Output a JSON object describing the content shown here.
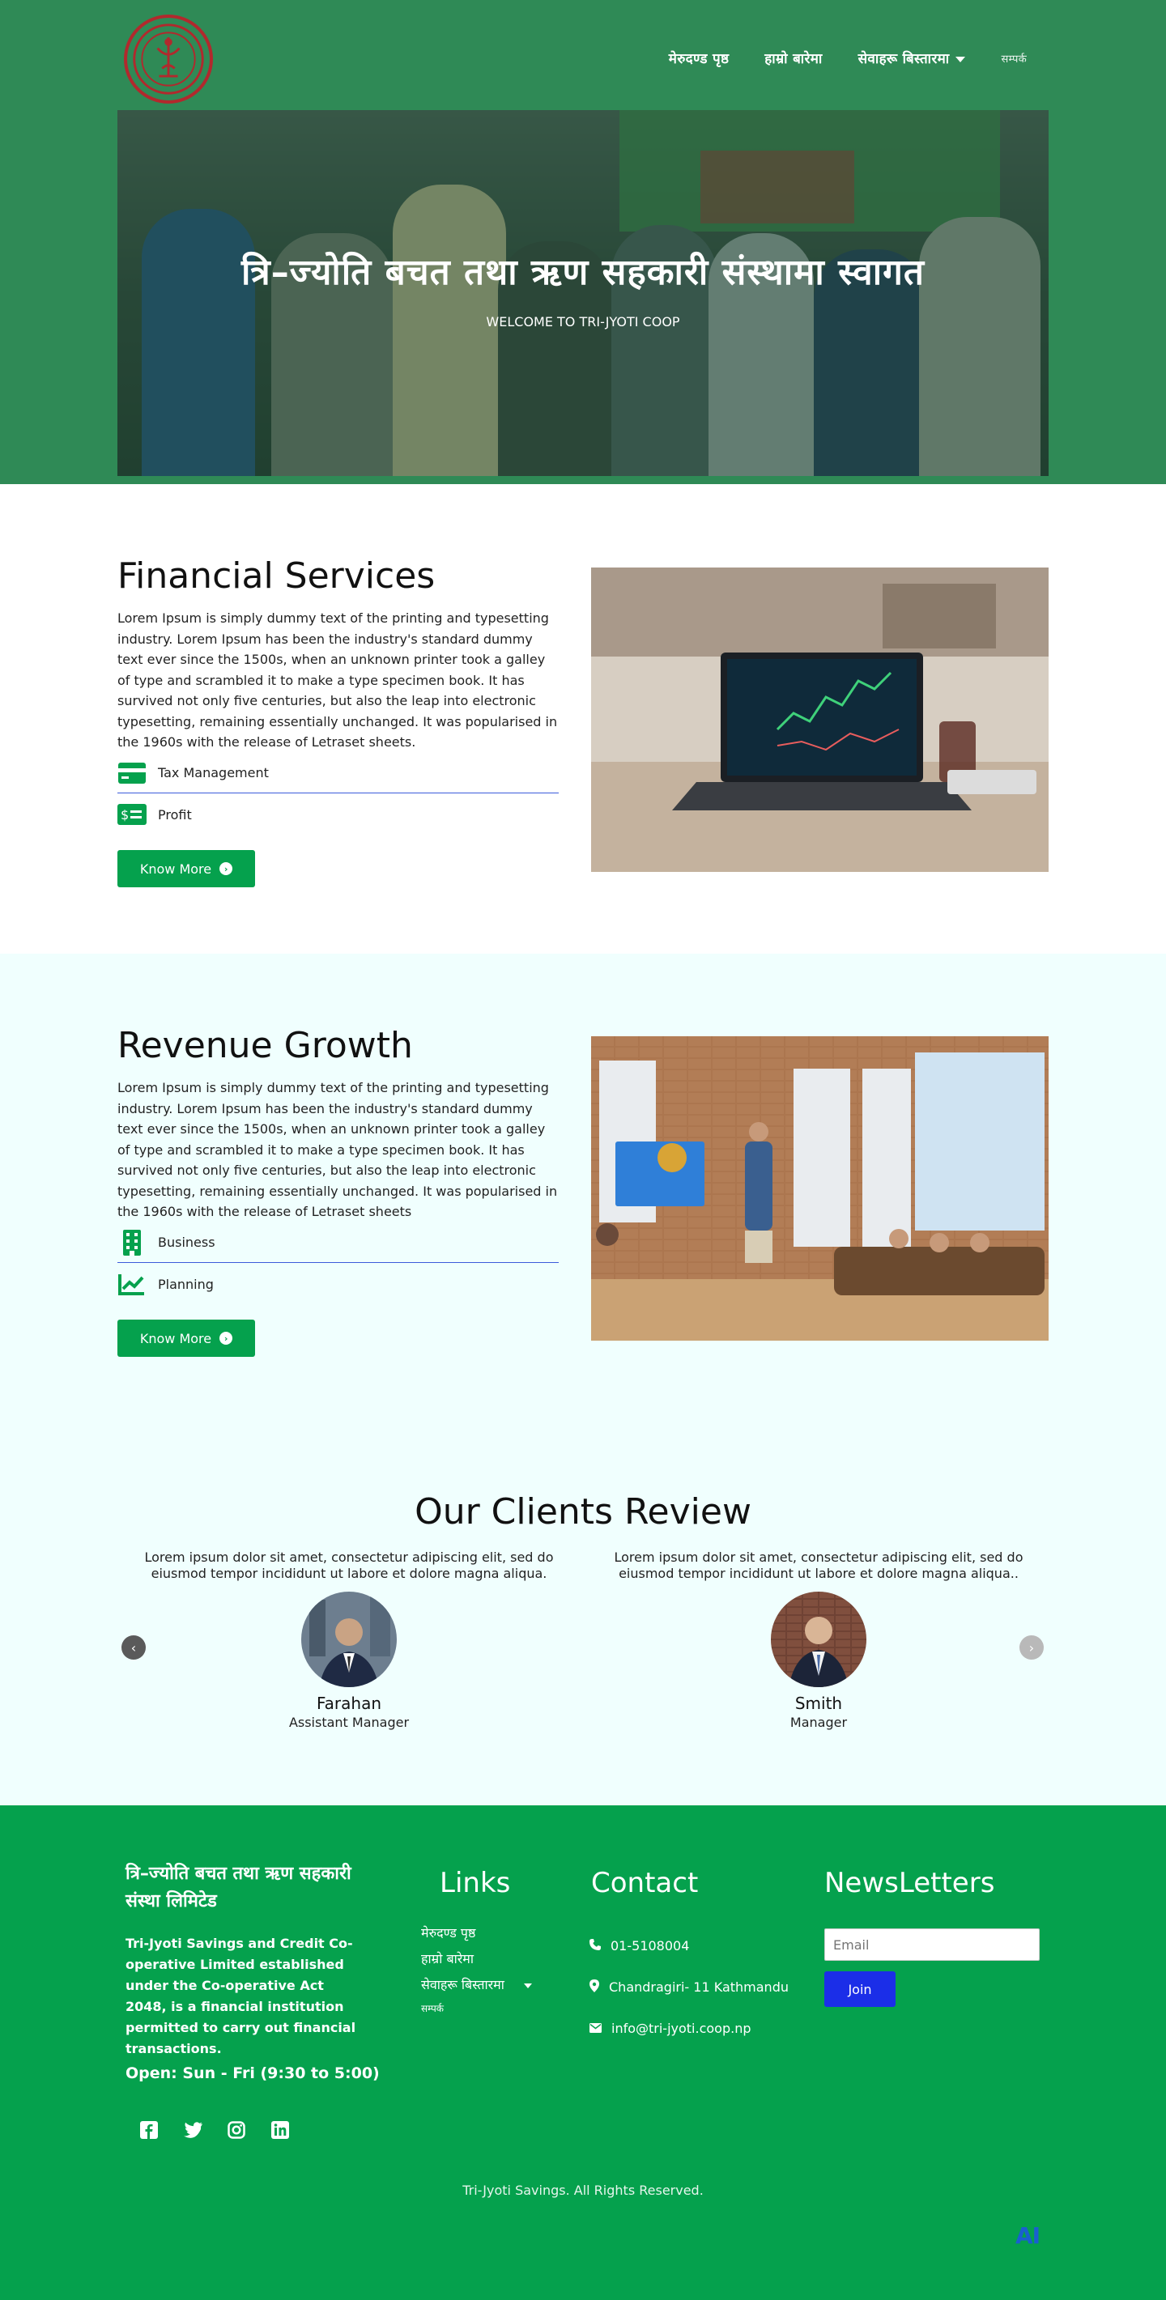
{
  "header": {
    "nav": [
      {
        "label": "मेरुदण्ड पृष्ठ"
      },
      {
        "label": "हाम्रो बारेमा"
      },
      {
        "label": "सेवाहरू बिस्तारमा"
      },
      {
        "label": "सम्पर्क"
      }
    ]
  },
  "hero": {
    "title": "त्रि–ज्योति बचत तथा ऋण सहकारी संस्थामा स्वागत",
    "subtitle": "WELCOME TO TRI-JYOTI COOP"
  },
  "financial": {
    "title": "Financial Services",
    "text": "Lorem Ipsum is simply dummy text of the printing and typesetting industry. Lorem Ipsum has been the industry's standard dummy text ever since the 1500s, when an unknown printer took a galley of type and scrambled it to make a type specimen book. It has survived not only five centuries, but also the leap into electronic typesetting, remaining essentially unchanged. It was popularised in the 1960s with the release of Letraset sheets.",
    "items": [
      {
        "label": "Tax Management",
        "icon": "credit-card-icon"
      },
      {
        "label": "Profit",
        "icon": "money-bill-icon"
      }
    ],
    "button": "Know More"
  },
  "revenue": {
    "title": "Revenue Growth",
    "text": "Lorem Ipsum is simply dummy text of the printing and typesetting industry. Lorem Ipsum has been the industry's standard dummy text ever since the 1500s, when an unknown printer took a galley of type and scrambled it to make a type specimen book. It has survived not only five centuries, but also the leap into electronic typesetting, remaining essentially unchanged. It was popularised in the 1960s with the release of Letraset sheets",
    "items": [
      {
        "label": "Business",
        "icon": "building-icon"
      },
      {
        "label": "Planning",
        "icon": "chart-line-icon"
      }
    ],
    "button": "Know More"
  },
  "reviews": {
    "title": "Our Clients Review",
    "items": [
      {
        "quote": "Lorem ipsum dolor sit amet, consectetur adipiscing elit, sed do eiusmod tempor incididunt ut labore et dolore magna aliqua.",
        "name": "Farahan",
        "role": "Assistant Manager"
      },
      {
        "quote": "Lorem ipsum dolor sit amet, consectetur adipiscing elit, sed do eiusmod tempor incididunt ut labore et dolore magna aliqua..",
        "name": "Smith",
        "role": "Manager"
      }
    ],
    "prev": "‹",
    "next": "›"
  },
  "footer": {
    "brand": "त्रि–ज्योति बचत तथा ऋण सहकारी संस्था लिमिटेड",
    "desc": "Tri-Jyoti Savings and Credit Co-operative Limited established under the Co-operative Act 2048, is a financial institution permitted to carry out financial transactions.",
    "open": "Open: Sun - Fri (9:30 to 5:00)",
    "links_title": "Links",
    "links": [
      "मेरुदण्ड पृष्ठ",
      "हाम्रो बारेमा",
      "सेवाहरू बिस्तारमा",
      "सम्पर्क"
    ],
    "contact_title": "Contact",
    "phone": "01-5108004",
    "address": "Chandragiri- 11 Kathmandu",
    "email": "info@tri-jyoti.coop.np",
    "news_title": "NewsLetters",
    "email_placeholder": "Email",
    "join": "Join",
    "copyright": "Tri-Jyoti Savings. All Rights Reserved.",
    "badge": "AI"
  },
  "colors": {
    "header_green": "#2f8a56",
    "button_green": "#05a14d",
    "footer_green": "#05a14d",
    "join_blue": "#1b2ee8",
    "light_bg": "#f0fffe"
  }
}
